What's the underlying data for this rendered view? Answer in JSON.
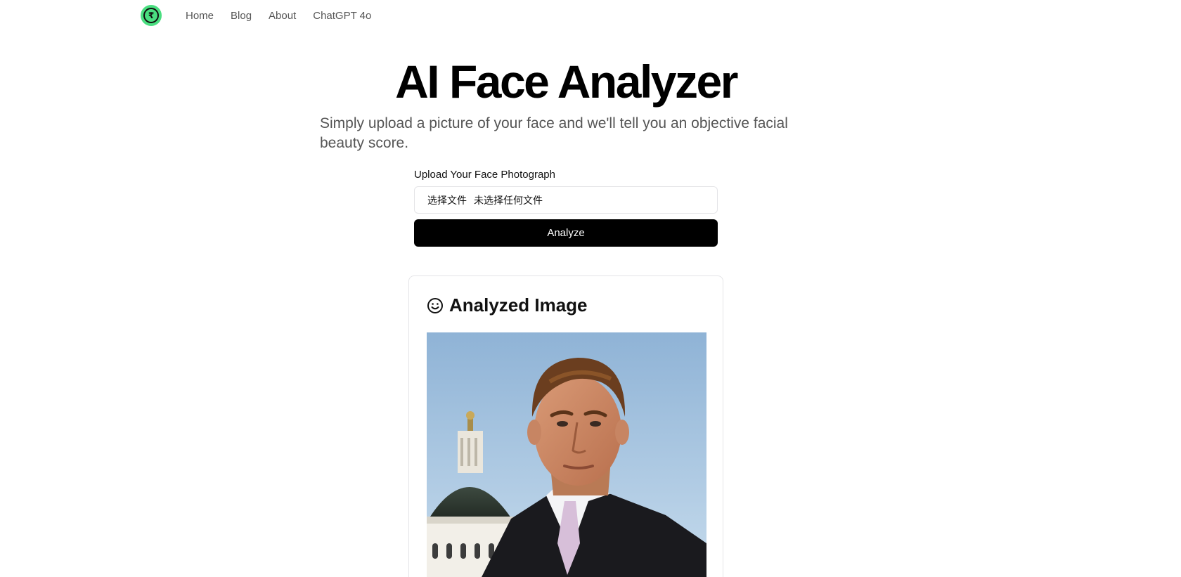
{
  "nav": {
    "logo_name": "brand-logo",
    "links": [
      "Home",
      "Blog",
      "About",
      "ChatGPT 4o"
    ]
  },
  "hero": {
    "title": "AI Face Analyzer",
    "subtitle": "Simply upload a picture of your face and we'll tell you an objective facial beauty score."
  },
  "upload": {
    "label": "Upload Your Face Photograph",
    "choose_file_button": "选择文件",
    "file_status": "未选择任何文件",
    "analyze_button": "Analyze"
  },
  "result": {
    "title": "Analyzed Image",
    "icon": "smile-icon"
  },
  "colors": {
    "accent": "#000000",
    "logo": "#4ade80",
    "muted_text": "#555555",
    "border": "#e4e4e7"
  }
}
